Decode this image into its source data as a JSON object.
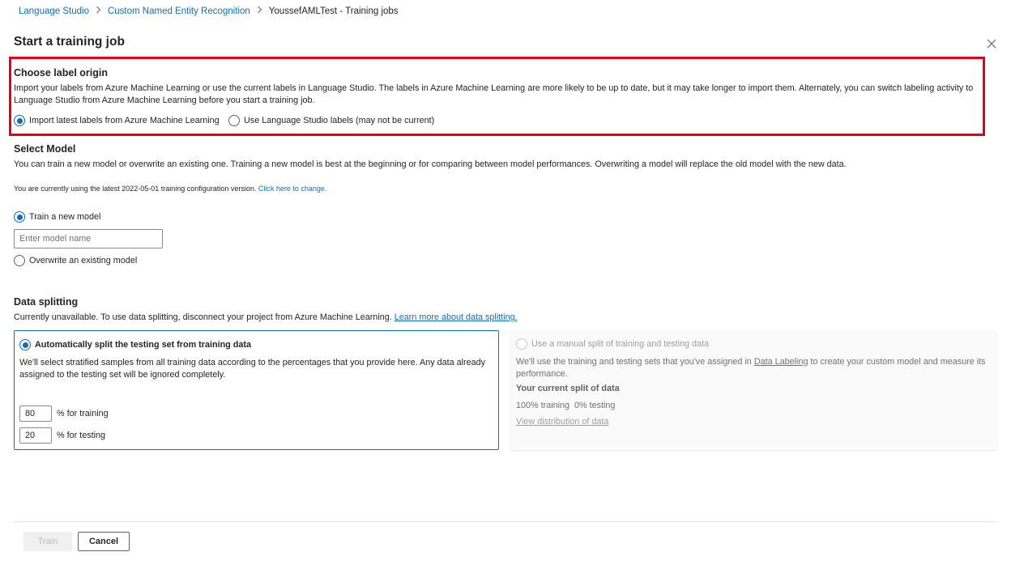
{
  "breadcrumb": {
    "items": [
      "Language Studio",
      "Custom Named Entity Recognition",
      "YoussefAMLTest - Training jobs"
    ]
  },
  "page": {
    "title": "Start a training job"
  },
  "label_origin": {
    "title": "Choose label origin",
    "description": "Import your labels from Azure Machine Learning or use the current labels in Language Studio. The labels in Azure Machine Learning are more likely to be up to date, but it may take longer to import them. Alternately, you can switch labeling activity to Language Studio from Azure Machine Learning before you start a training job.",
    "options": [
      {
        "label": "Import latest labels from Azure Machine Learning",
        "selected": true
      },
      {
        "label": "Use Language Studio labels (may not be current)",
        "selected": false
      }
    ]
  },
  "select_model": {
    "title": "Select Model",
    "description": "You can train a new model or overwrite an existing one. Training a new model is best at the beginning or for comparing between model performances. Overwriting a model will replace the old model with the new data.",
    "config_note": "You are currently using the latest 2022-05-01 training configuration version.",
    "config_link": "Click here to change.",
    "train_new_label": "Train a new model",
    "model_name_placeholder": "Enter model name",
    "overwrite_label": "Overwrite an existing model"
  },
  "data_splitting": {
    "title": "Data splitting",
    "description": "Currently unavailable. To use data splitting, disconnect your project from Azure Machine Learning.",
    "learn_more": "Learn more about data splitting.",
    "auto": {
      "title": "Automatically split the testing set from training data",
      "description": "We'll select stratified samples from all training data according to the percentages that you provide here. Any data already assigned to the testing set will be ignored completely.",
      "training_value": "80",
      "training_label": "% for training",
      "testing_value": "20",
      "testing_label": "% for testing"
    },
    "manual": {
      "title": "Use a manual split of training and testing data",
      "description_pre": "We'll use the training and testing sets that you've assigned in",
      "data_labeling_link": "Data Labeling",
      "description_post": "to create your custom model and measure its performance.",
      "current_split_title": "Your current split of data",
      "current_split_value": "100% training  0% testing",
      "view_distribution": "View distribution of data"
    }
  },
  "footer": {
    "train_label": "Train",
    "cancel_label": "Cancel"
  },
  "colors": {
    "accent": "#0f6cbd",
    "highlight": "#e3001b"
  }
}
